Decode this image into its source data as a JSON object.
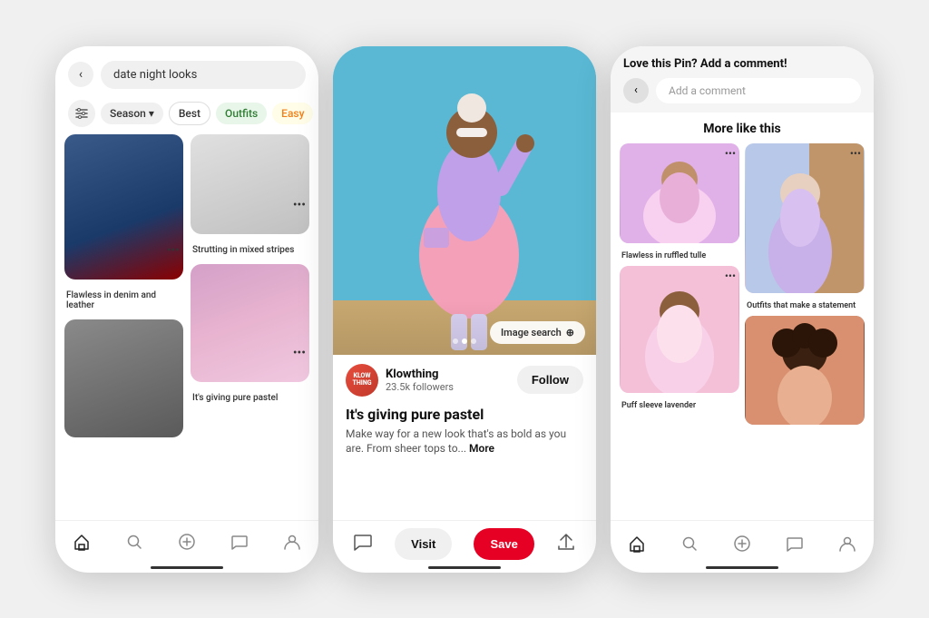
{
  "phone1": {
    "search": {
      "back_icon": "‹",
      "query": "date night looks",
      "filter_icon": "⊞"
    },
    "chips": [
      {
        "label": "Season",
        "type": "season",
        "arrow": "▾"
      },
      {
        "label": "Best",
        "type": "best"
      },
      {
        "label": "Outfits",
        "type": "outfits"
      },
      {
        "label": "Easy",
        "type": "easy"
      }
    ],
    "pins": [
      {
        "label": "Flawless in denim and leather",
        "more": "•••"
      },
      {
        "label": "Strutting in mixed stripes",
        "more": "•••"
      },
      {
        "label": "It's giving pure pastel",
        "more": "•••"
      },
      {
        "label": "",
        "more": ""
      }
    ],
    "nav": {
      "home": "⌂",
      "search": "🔍",
      "plus": "+",
      "chat": "💬",
      "profile": "👤"
    }
  },
  "phone2": {
    "hero": {
      "prev_icon": "‹",
      "more_icon": "⋯",
      "image_search_label": "Image search",
      "search_icon": "⊕"
    },
    "creator": {
      "avatar_text": "KLOW\nTHING",
      "name": "Klowthing",
      "followers": "23.5k followers",
      "follow_label": "Follow"
    },
    "pin": {
      "title": "It's giving pure pastel",
      "description": "Make way for a new look that's as bold as you are. From sheer tops to...",
      "more_label": "More"
    },
    "actions": {
      "comment_icon": "💬",
      "visit_label": "Visit",
      "save_label": "Save",
      "share_icon": "↑"
    },
    "nav": {
      "home": "⌂",
      "search": "🔍",
      "plus": "+",
      "chat": "💬",
      "profile": "👤"
    }
  },
  "phone3": {
    "comment_section": {
      "title": "Love this Pin? Add a comment!",
      "placeholder": "Add a comment",
      "back_icon": "‹"
    },
    "more_like": {
      "title": "More like this",
      "cards": [
        {
          "label": "Flawless in ruffled tulle",
          "more": "•••"
        },
        {
          "label": "Outfits that make a statement",
          "more": "•••"
        },
        {
          "label": "Puff sleeve lavender",
          "more": "•••"
        },
        {
          "label": "",
          "more": ""
        }
      ]
    },
    "nav": {
      "home": "⌂",
      "search": "🔍",
      "plus": "+",
      "chat": "💬",
      "profile": "👤"
    }
  }
}
